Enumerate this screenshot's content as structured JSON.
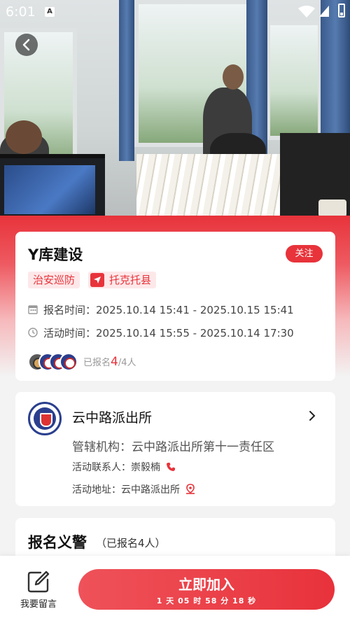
{
  "status_bar": {
    "time": "6:01",
    "notification_icon": "A"
  },
  "hero": {
    "image": "office-photo"
  },
  "activity": {
    "title": "Y库建设",
    "follow_label": "关注",
    "tags": {
      "category": "治安巡防",
      "location": "托克托县"
    },
    "signup_time_label": "报名时间：",
    "signup_time": "2025.10.14 15:41 - 2025.10.15 15:41",
    "activity_time_label": "活动时间：",
    "activity_time": "2025.10.14 15:55 - 2025.10.14 17:30",
    "signed_prefix": "已报名",
    "signed_count": "4",
    "signed_suffix": "/4人"
  },
  "organization": {
    "name": "云中路派出所",
    "jurisdiction_label": "管辖机构：",
    "jurisdiction": "云中路派出所第十一责任区",
    "contact_label": "活动联系人：",
    "contact": "崇毅楠",
    "address_label": "活动地址：",
    "address": "云中路派出所"
  },
  "volunteers": {
    "title": "报名义警",
    "subtitle": "（已报名4人）"
  },
  "bottom_bar": {
    "message_label": "我要留言",
    "join_label": "立即加入",
    "countdown": "1 天 05 时 58 分 18 秒"
  },
  "colors": {
    "accent": "#e8333b",
    "tag_bg": "#fde8e9"
  }
}
